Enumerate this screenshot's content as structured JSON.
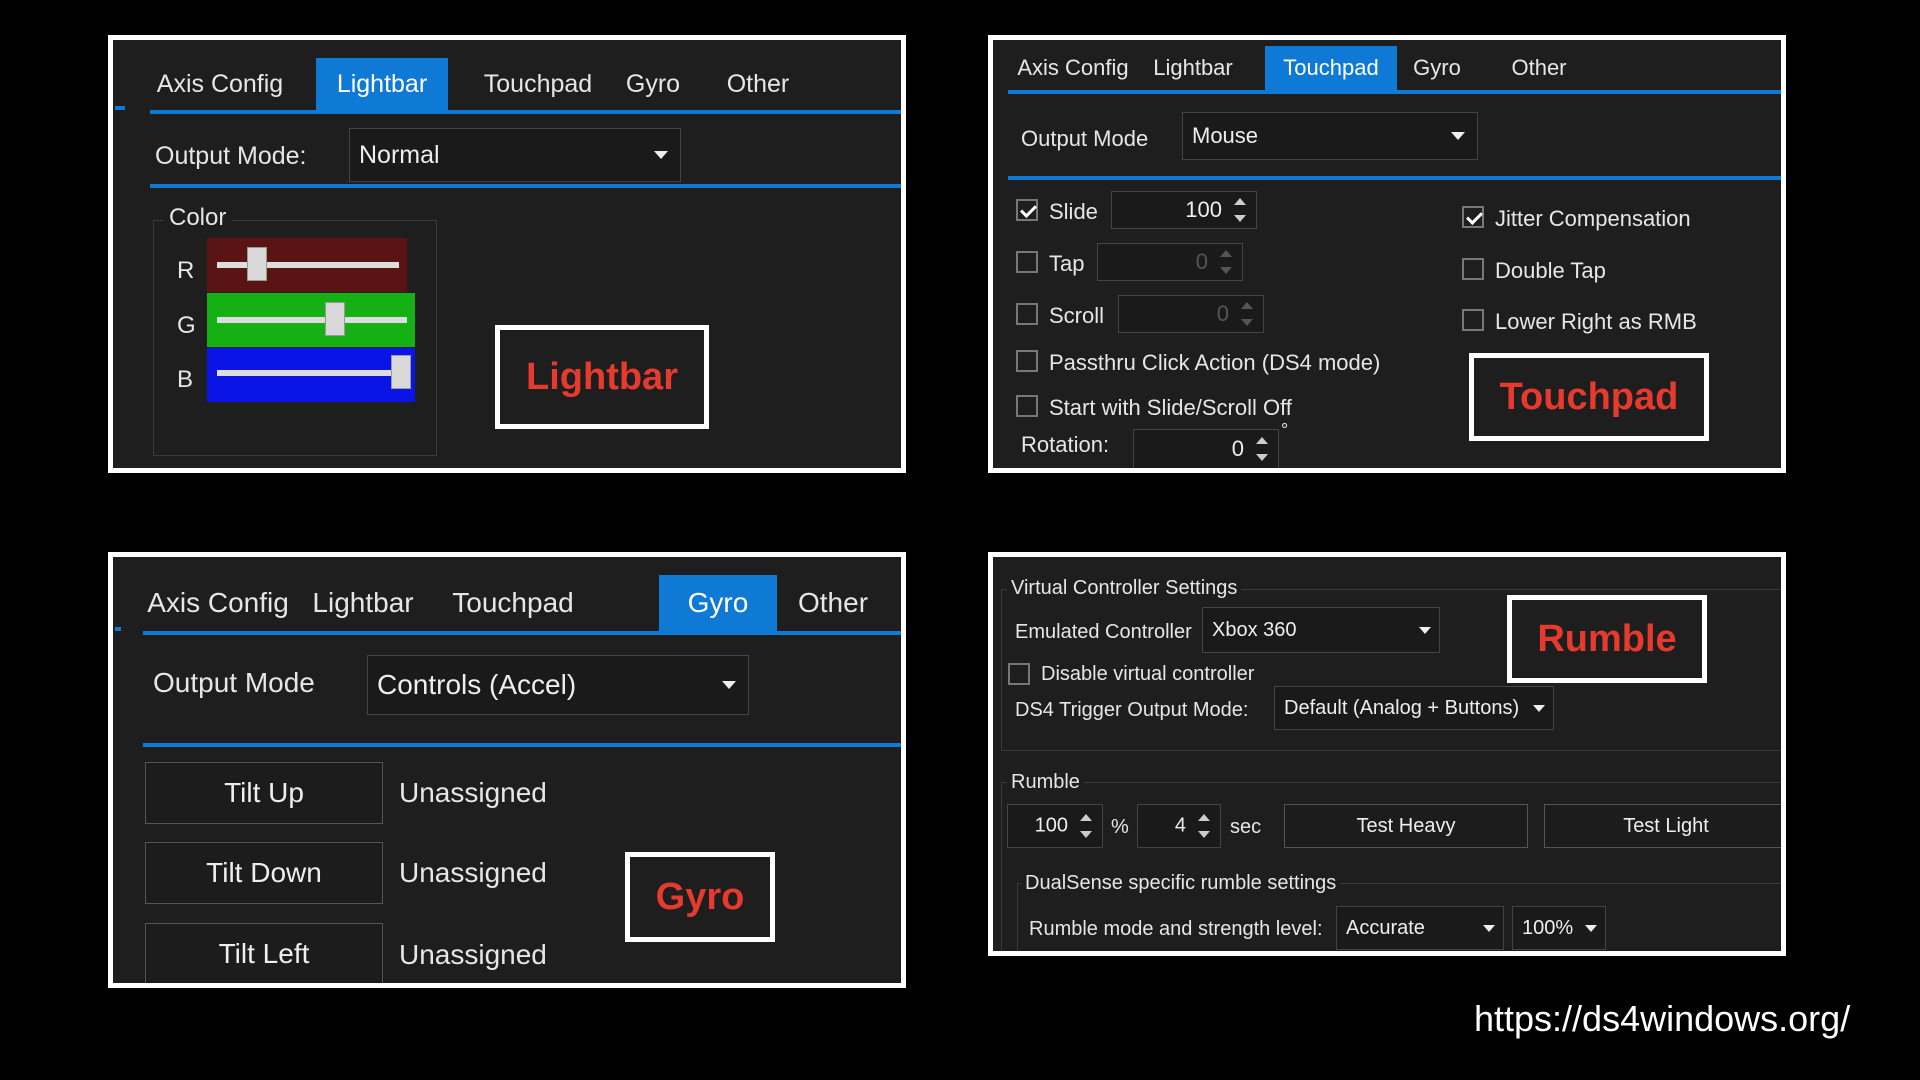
{
  "lightbar_panel": {
    "tabs": [
      "Axis Config",
      "Lightbar",
      "Touchpad",
      "Gyro",
      "Other"
    ],
    "output_mode_label": "Output Mode:",
    "output_mode_value": "Normal",
    "color_group_label": "Color",
    "channels": [
      "R",
      "G",
      "B"
    ],
    "channel_colors": [
      "#5a1414",
      "#14b014",
      "#0a14e6"
    ],
    "callout": "Lightbar"
  },
  "touchpad_panel": {
    "tabs": [
      "Axis Config",
      "Lightbar",
      "Touchpad",
      "Gyro",
      "Other"
    ],
    "output_mode_label": "Output Mode",
    "output_mode_value": "Mouse",
    "slide_label": "Slide",
    "slide_value": "100",
    "tap_label": "Tap",
    "tap_value": "0",
    "scroll_label": "Scroll",
    "scroll_value": "0",
    "passthru_label": "Passthru Click Action (DS4 mode)",
    "start_off_label": "Start with Slide/Scroll Off",
    "rotation_label": "Rotation:",
    "rotation_value": "0",
    "rotation_unit": "°",
    "jitter_label": "Jitter Compensation",
    "double_tap_label": "Double Tap",
    "lower_right_label": "Lower Right as RMB",
    "callout": "Touchpad"
  },
  "gyro_panel": {
    "tabs": [
      "Axis Config",
      "Lightbar",
      "Touchpad",
      "Gyro",
      "Other"
    ],
    "output_mode_label": "Output Mode",
    "output_mode_value": "Controls (Accel)",
    "rows": [
      {
        "button": "Tilt Up",
        "value": "Unassigned"
      },
      {
        "button": "Tilt Down",
        "value": "Unassigned"
      },
      {
        "button": "Tilt Left",
        "value": "Unassigned"
      }
    ],
    "callout": "Gyro"
  },
  "rumble_panel": {
    "vc_group_label": "Virtual Controller Settings",
    "emulated_label": "Emulated Controller",
    "emulated_value": "Xbox 360",
    "disable_label": "Disable virtual controller",
    "trigger_label": "DS4 Trigger Output Mode:",
    "trigger_value": "Default (Analog + Buttons)",
    "rumble_group_label": "Rumble",
    "strength_value": "100",
    "percent_sign": "%",
    "duration_value": "4",
    "sec_label": "sec",
    "test_heavy": "Test Heavy",
    "test_light": "Test Light",
    "dualsense_group_label": "DualSense specific rumble settings",
    "rumble_mode_label": "Rumble mode and strength level:",
    "rumble_mode_value": "Accurate",
    "rumble_level_value": "100%",
    "callout": "Rumble"
  },
  "footer_url": "https://ds4windows.org/",
  "colors": {
    "accent": "#0f79d6",
    "callout_text": "#e63a2e",
    "panel_bg": "#1e1e1e"
  }
}
